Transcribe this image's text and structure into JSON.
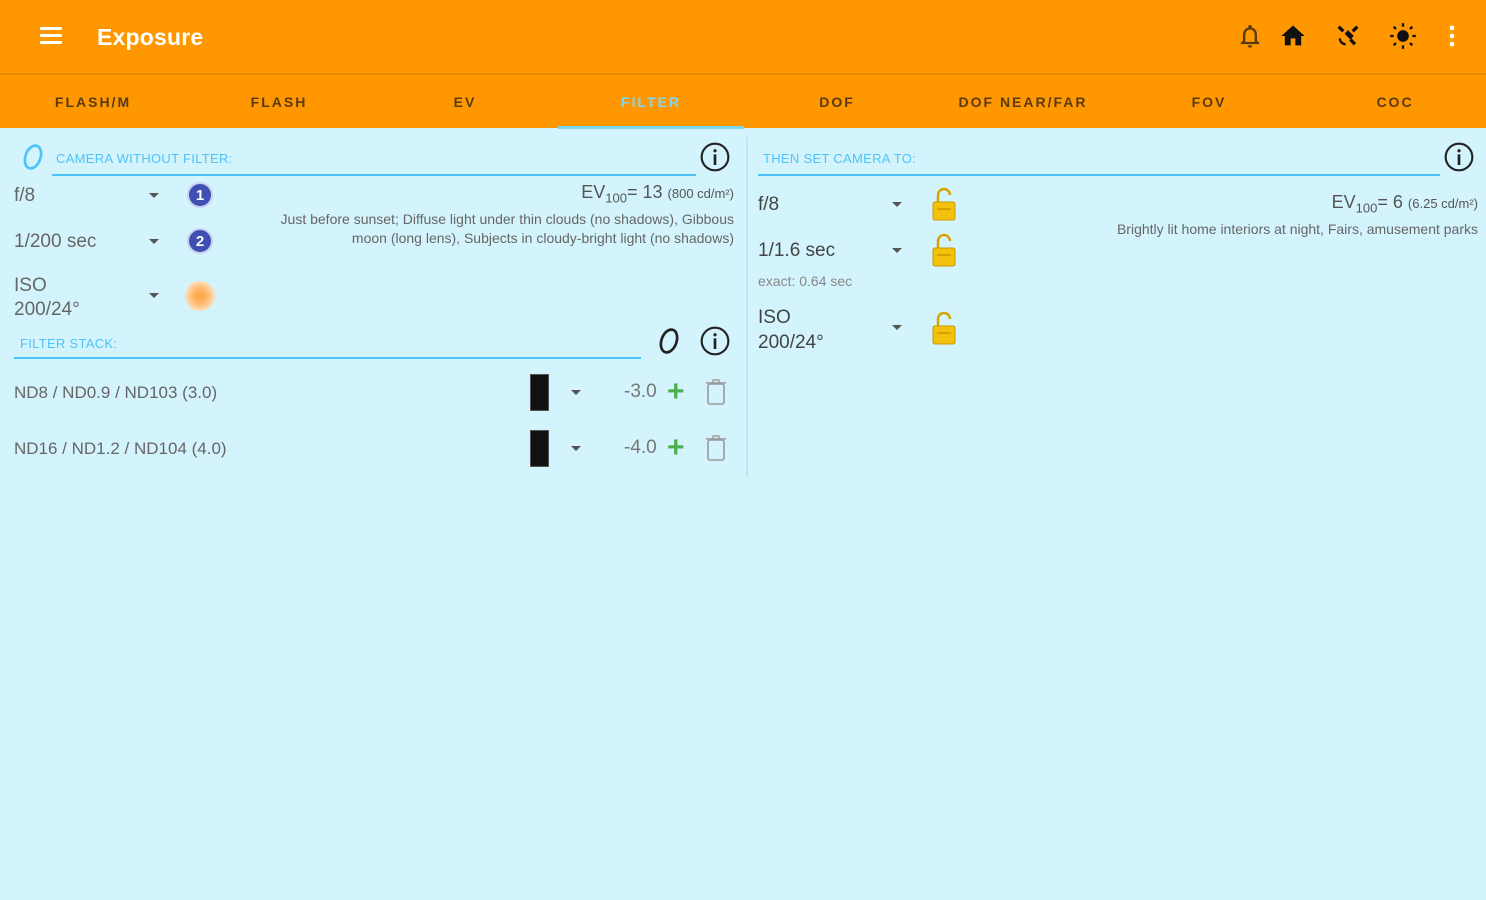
{
  "appbar": {
    "title": "Exposure",
    "icons": [
      "menu-icon",
      "bell-icon",
      "home-icon",
      "satellite-icon",
      "brightness-icon",
      "more-vert-icon"
    ]
  },
  "tabs": [
    {
      "label": "FLASH/M"
    },
    {
      "label": "FLASH"
    },
    {
      "label": "EV"
    },
    {
      "label": "FILTER",
      "active": true
    },
    {
      "label": "DOF"
    },
    {
      "label": "DOF NEAR/FAR"
    },
    {
      "label": "FOV"
    },
    {
      "label": "COC"
    }
  ],
  "left": {
    "header": "CAMERA WITHOUT FILTER:",
    "aperture": "f/8",
    "shutter": "1/200 sec",
    "iso_line1": "ISO",
    "iso_line2": "200/24°",
    "badge1": "1",
    "badge2": "2",
    "ev_prefix": "EV",
    "ev_sub": "100",
    "ev_value": "= 13",
    "ev_lum": "(800 cd/m²)",
    "desc": "Just before sunset; Diffuse light under thin clouds (no shadows), Gibbous moon (long lens), Subjects in cloudy-bright light (no shadows)",
    "filter_header": "FILTER STACK:",
    "filters": [
      {
        "name": "ND8 / ND0.9 / ND103 (3.0)",
        "value": "-3.0"
      },
      {
        "name": "ND16 / ND1.2 / ND104 (4.0)",
        "value": "-4.0"
      }
    ]
  },
  "right": {
    "header": "THEN SET CAMERA TO:",
    "aperture": "f/8",
    "shutter": "1/1.6 sec",
    "exact": "exact: 0.64 sec",
    "iso_line1": "ISO",
    "iso_line2": "200/24°",
    "ev_prefix": "EV",
    "ev_sub": "100",
    "ev_value": "= 6",
    "ev_lum": "(6.25 cd/m²)",
    "desc": "Brightly lit home interiors at night, Fairs, amusement parks"
  },
  "colors": {
    "appbar": "#ff9800",
    "background": "#d3f4fc",
    "accent": "#4fc3f7",
    "add": "#4caf50",
    "lock": "#f4c20d"
  }
}
